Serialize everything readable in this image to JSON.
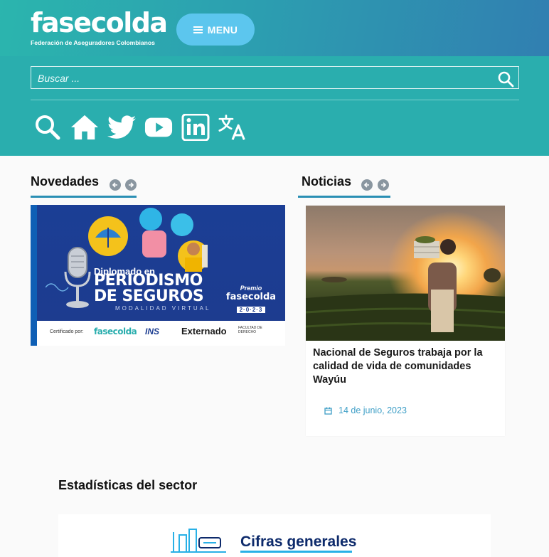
{
  "header": {
    "logo_word": "fasecolda",
    "logo_subtitle": "Federación de Aseguradores Colombianos",
    "menu_label": "MENU",
    "search_placeholder": "Buscar ...",
    "social_icons": [
      "search-icon",
      "home-icon",
      "twitter-icon",
      "youtube-icon",
      "linkedin-icon",
      "translate-icon"
    ]
  },
  "novedades": {
    "title": "Novedades",
    "banner": {
      "line1": "Diplomado en",
      "line2": "PERIODISMO",
      "line3": "DE SEGUROS",
      "modalidad": "MODALIDAD VIRTUAL",
      "premio_line1": "Premio",
      "premio_line2": "fasecolda",
      "premio_line3": "al periodismo de seguros",
      "premio_year": "2·0·2·3",
      "cert_label": "Certificado por:",
      "footer_logo1": "fasecolda",
      "footer_logo2": "INS",
      "footer_logo3": "Externado",
      "footer_logo3_small": "Universidad",
      "footer_logo4": "FACULTAD DE DERECHO"
    }
  },
  "noticias": {
    "title": "Noticias",
    "card": {
      "title": "Nacional de Seguros trabaja por la calidad de vida de comunidades Wayúu",
      "date": "14 de junio, 2023"
    }
  },
  "estadisticas": {
    "title": "Estadísticas del sector",
    "card_label": "Cifras generales"
  },
  "colors": {
    "header_teal": "#2aaeae",
    "header_blue": "#3579b0",
    "menu_button": "#5cc6ee",
    "underline": "#2a8fb4",
    "date_blue": "#3f9fc7",
    "stats_navy": "#0d2a6b"
  }
}
